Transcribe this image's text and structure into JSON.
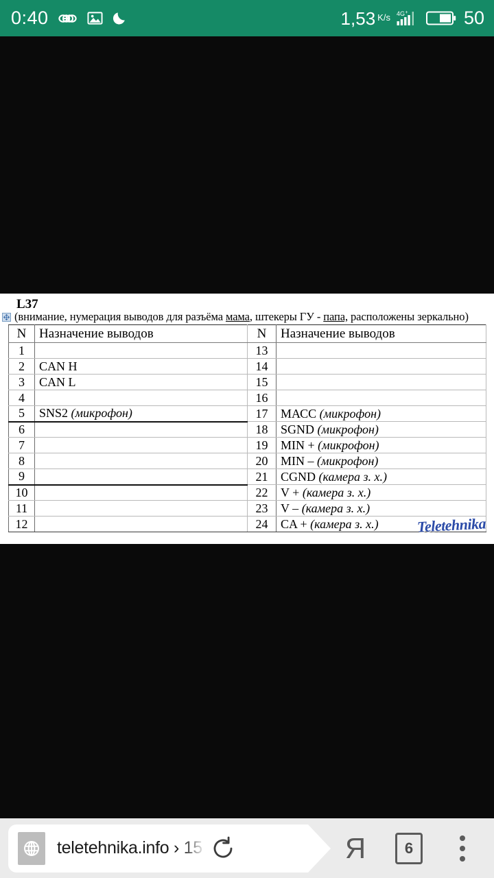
{
  "status_bar": {
    "time": "0:40",
    "infinity_icon": "infinity-icon",
    "gallery_icon": "image-icon",
    "dnd_icon": "crescent-moon-icon",
    "network_speed": "1,53",
    "network_speed_unit": "K/s",
    "mobile_network": "4G+",
    "signal_icon": "signal-bars-icon",
    "battery_icon": "battery-icon",
    "battery_percent": "50",
    "background_color": "#158a66",
    "text_color": "#ffffff"
  },
  "document": {
    "title": "L37",
    "subtitle_parts": {
      "p1": "(внимание, нумерация выводов  для разъёма ",
      "u1": "мама",
      "p2": ", штекеры ГУ - ",
      "u2": "папа,",
      "p3": " расположены зеркально)"
    },
    "table_handle_icon": "table-move-handle-icon",
    "watermark": "Teletehnika",
    "watermark_color": "#2b4ba8",
    "table": {
      "headers": [
        "N",
        "Назначение выводов",
        "N",
        "Назначение выводов"
      ],
      "rows": [
        {
          "n_left": "1",
          "desc_left": "",
          "n_right": "13",
          "desc_right": ""
        },
        {
          "n_left": "2",
          "desc_left": "CAN H",
          "n_right": "14",
          "desc_right": ""
        },
        {
          "n_left": "3",
          "desc_left": "CAN L",
          "n_right": "15",
          "desc_right": ""
        },
        {
          "n_left": "4",
          "desc_left": "",
          "n_right": "16",
          "desc_right": ""
        },
        {
          "n_left": "5",
          "desc_left": "SNS2 (микрофон)",
          "n_right": "17",
          "desc_right": "МАСС (микрофон)"
        },
        {
          "n_left": "6",
          "desc_left": "",
          "n_right": "18",
          "desc_right": "SGND (микрофон)"
        },
        {
          "n_left": "7",
          "desc_left": "",
          "n_right": "19",
          "desc_right": "MIN + (микрофон)"
        },
        {
          "n_left": "8",
          "desc_left": "",
          "n_right": "20",
          "desc_right": "MIN – (микрофон)"
        },
        {
          "n_left": "9",
          "desc_left": "",
          "n_right": "21",
          "desc_right": "CGND (камера з. х.)"
        },
        {
          "n_left": "10",
          "desc_left": "",
          "n_right": "22",
          "desc_right": "V + (камера з. х.)"
        },
        {
          "n_left": "11",
          "desc_left": "",
          "n_right": "23",
          "desc_right": "V – (камера з. х.)"
        },
        {
          "n_left": "12",
          "desc_left": "",
          "n_right": "24",
          "desc_right": "CA + (камера з. х.)"
        }
      ]
    }
  },
  "browser_bar": {
    "site_icon": "globe-icon",
    "url": "teletehnika.info › 15",
    "reload_icon": "reload-icon",
    "yandex_logo": "Я",
    "tab_count": "6",
    "menu_icon": "three-dot-menu-icon",
    "background_color": "#ebebeb"
  }
}
